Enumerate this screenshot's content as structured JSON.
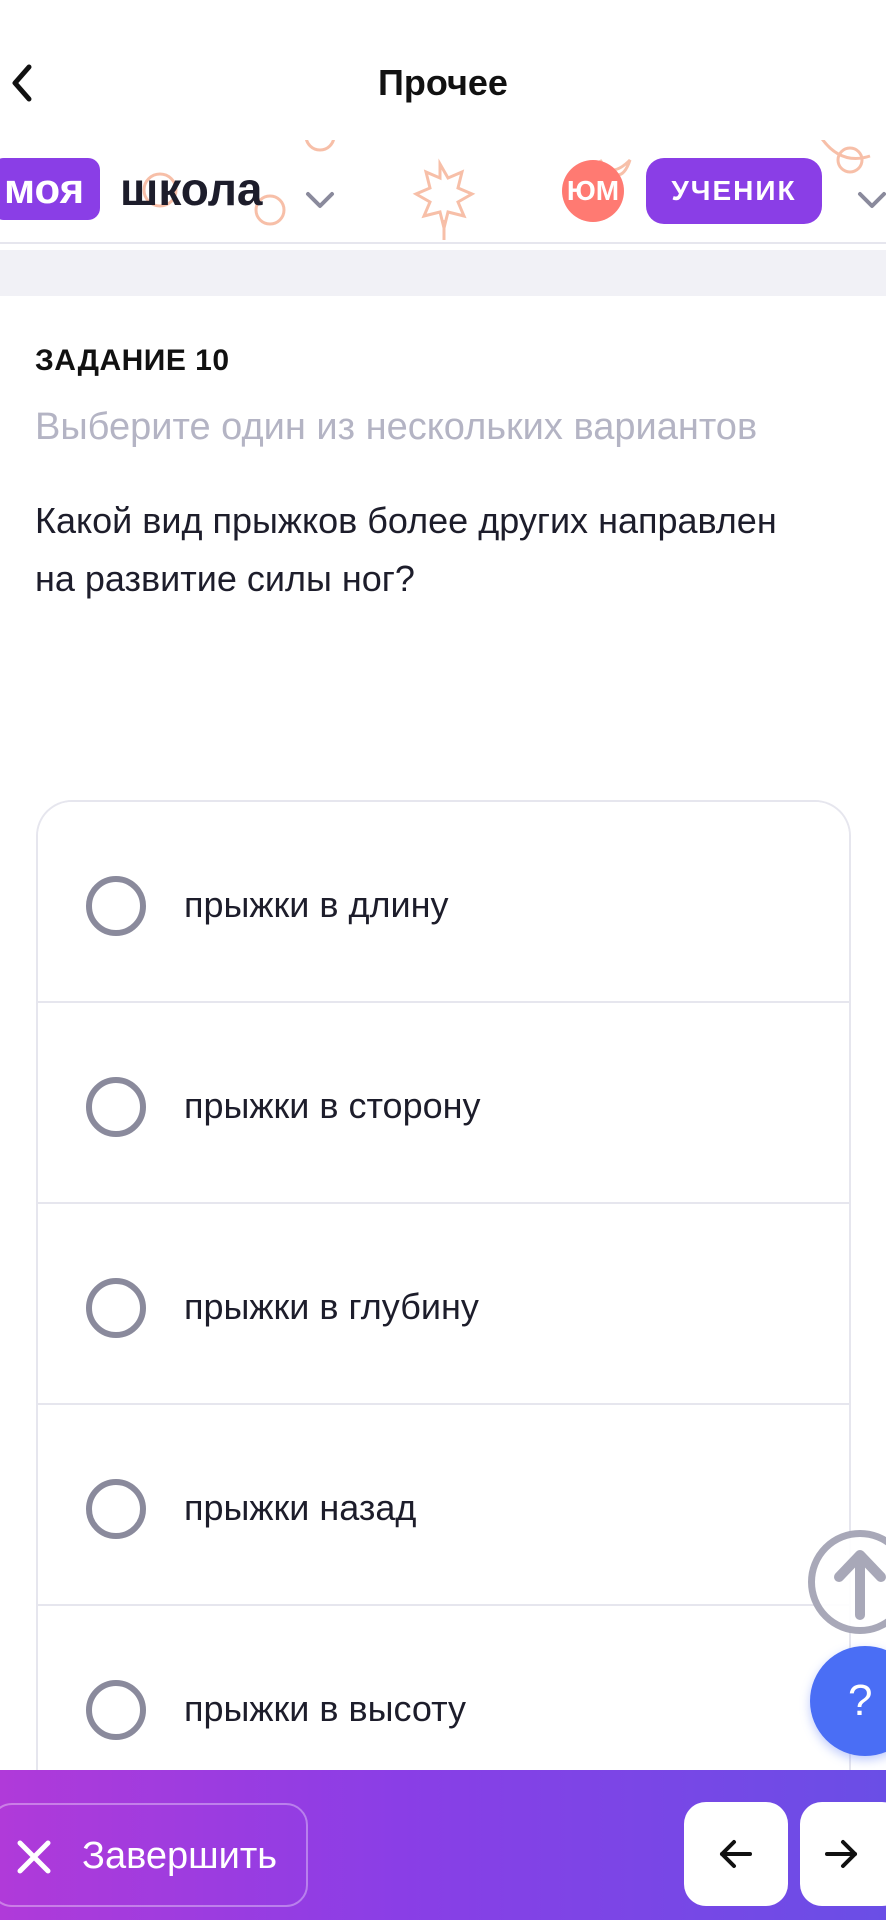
{
  "topbar": {
    "title": "Прочее"
  },
  "header": {
    "logo_highlight": "моя",
    "logo_text": "школа",
    "avatar_initials": "ЮМ",
    "role": "УЧЕНИК"
  },
  "task": {
    "label": "ЗАДАНИЕ 10",
    "hint": "Выберите один из нескольких вариантов",
    "question": "Какой вид прыжков более других направлен на развитие силы ног?"
  },
  "options": [
    {
      "label": "прыжки в длину",
      "selected": false
    },
    {
      "label": "прыжки в сторону",
      "selected": false
    },
    {
      "label": "прыжки в глубину",
      "selected": false
    },
    {
      "label": "прыжки назад",
      "selected": false
    },
    {
      "label": "прыжки в высоту",
      "selected": false
    }
  ],
  "help": {
    "label": "?"
  },
  "footer": {
    "finish_label": "Завершить"
  },
  "colors": {
    "accent": "#8a3ee6",
    "avatar": "#ff7a72",
    "help": "#4a6ef5",
    "hint_text": "#b4b4c4",
    "decor": "#f6b59a"
  },
  "icons": [
    "chevron-left-icon",
    "chevron-down-icon",
    "maple-leaf-icon",
    "arrow-up-icon",
    "close-icon",
    "arrow-left-icon",
    "arrow-right-icon"
  ]
}
